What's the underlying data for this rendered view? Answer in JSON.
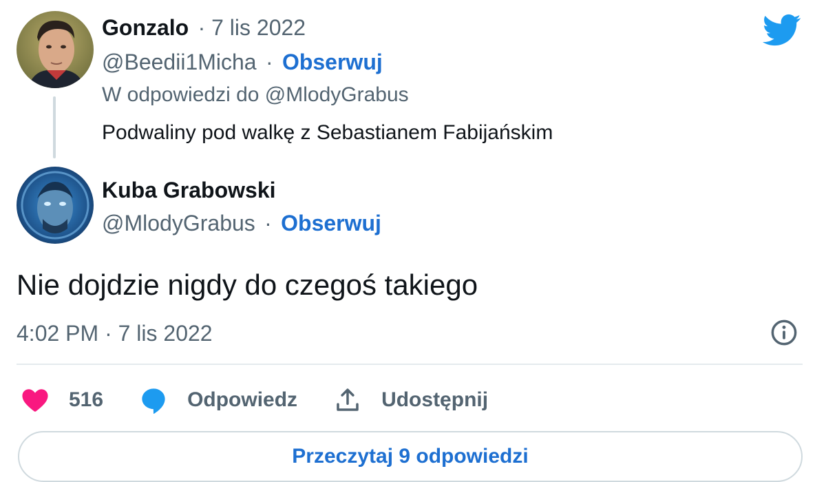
{
  "reply_tweet": {
    "name": "Gonzalo",
    "date": "· 7 lis 2022",
    "handle": "@Beedii1Micha",
    "separator": "·",
    "follow_label": "Obserwuj",
    "replying_to": "W odpowiedzi do @MlodyGrabus",
    "text": "Podwaliny pod walkę z Sebastianem Fabijańskim"
  },
  "main_tweet": {
    "name": "Kuba Grabowski",
    "handle": "@MlodyGrabus",
    "separator": "·",
    "follow_label": "Obserwuj",
    "text": "Nie dojdzie nigdy do czegoś takiego",
    "timestamp": "4:02 PM · 7 lis 2022"
  },
  "actions": {
    "like_count": "516",
    "reply_label": "Odpowiedz",
    "share_label": "Udostępnij"
  },
  "read_replies_label": "Przeczytaj 9 odpowiedzi",
  "colors": {
    "accent": "#1d6fd1",
    "twitter_blue": "#1d9bf0",
    "heart": "#f91880",
    "muted_text": "#536471"
  },
  "icons": [
    "twitter-bird-icon",
    "info-icon",
    "heart-icon",
    "reply-bubble-icon",
    "share-icon"
  ]
}
